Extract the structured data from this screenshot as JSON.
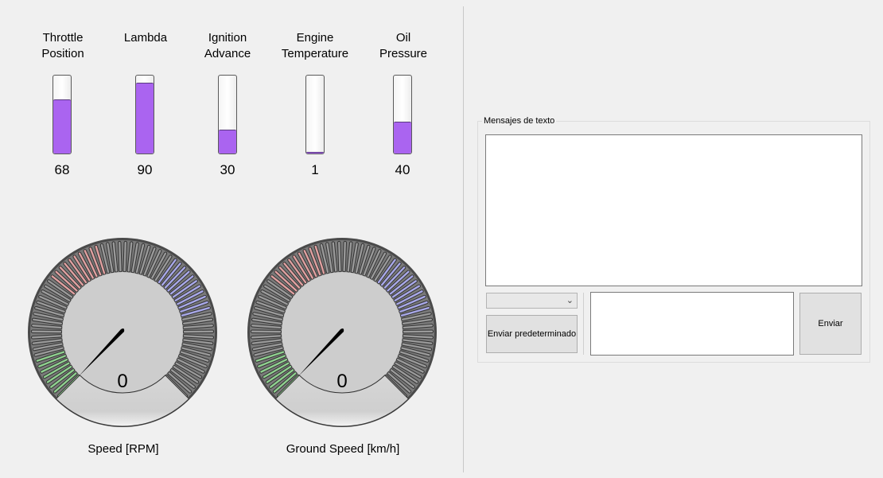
{
  "bars": [
    {
      "label_line1": "Throttle",
      "label_line2": "Position",
      "value": 68,
      "display": "68"
    },
    {
      "label_line1": "Lambda",
      "label_line2": "",
      "value": 90,
      "display": "90"
    },
    {
      "label_line1": "Ignition",
      "label_line2": "Advance",
      "value": 30,
      "display": "30"
    },
    {
      "label_line1": "Engine",
      "label_line2": "Temperature",
      "value": 1,
      "display": "1"
    },
    {
      "label_line1": "Oil",
      "label_line2": "Pressure",
      "value": 40,
      "display": "40"
    }
  ],
  "gauges": [
    {
      "label": "Speed [RPM]",
      "value": "0"
    },
    {
      "label": "Ground Speed [km/h]",
      "value": "0"
    }
  ],
  "messages": {
    "group_title": "Mensajes de texto",
    "preset_button": "Enviar predeterminado",
    "send_button": "Enviar",
    "preset_select_value": "",
    "message_input_value": "",
    "log_text": ""
  },
  "colors": {
    "bar_fill": "#aa64f0",
    "gauge_green": "#8fd08f",
    "gauge_red": "#e0a0a0",
    "gauge_blue": "#a8a8e8"
  }
}
